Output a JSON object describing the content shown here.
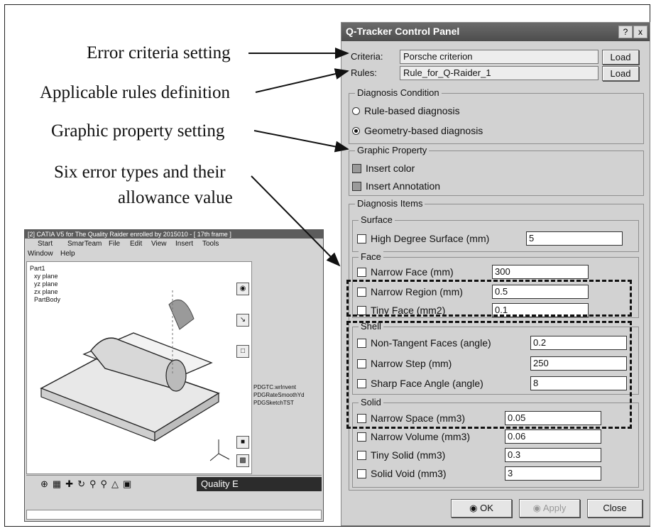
{
  "annotations": {
    "error_criteria": "Error criteria setting",
    "applicable_rules": "Applicable rules definition",
    "graphic_property": "Graphic property setting",
    "six_types_line1": "Six error types and their",
    "six_types_line2": "allowance value"
  },
  "panel": {
    "title": "Q-Tracker Control Panel",
    "help_btn": "?",
    "close_btn": "x",
    "criteria": {
      "label": "Criteria:",
      "value": "Porsche criterion",
      "button": "Load"
    },
    "rules": {
      "label": "Rules:",
      "value": "Rule_for_Q-Raider_1",
      "button": "Load"
    },
    "diagnosis_condition": {
      "title": "Diagnosis Condition",
      "options": [
        {
          "label": "Rule-based diagnosis",
          "selected": false
        },
        {
          "label": "Geometry-based diagnosis",
          "selected": true
        }
      ]
    },
    "graphic_property": {
      "title": "Graphic Property",
      "options": [
        {
          "label": "Insert color",
          "checked": true
        },
        {
          "label": "Insert Annotation",
          "checked": true
        }
      ]
    },
    "diagnosis_items": {
      "title": "Diagnosis Items",
      "surface": {
        "title": "Surface",
        "items": [
          {
            "label": "High Degree Surface (mm)",
            "value": "5"
          }
        ]
      },
      "face": {
        "title": "Face",
        "items": [
          {
            "label": "Narrow Face (mm)",
            "value": "300"
          },
          {
            "label": "Narrow Region (mm)",
            "value": "0.5"
          },
          {
            "label": "Tiny Face (mm2)",
            "value": "0.1"
          }
        ]
      },
      "shell": {
        "title": "Shell",
        "items": [
          {
            "label": "Non-Tangent Faces (angle)",
            "value": "0.2"
          },
          {
            "label": "Narrow Step (mm)",
            "value": "250"
          },
          {
            "label": "Sharp Face Angle (angle)",
            "value": "8"
          }
        ]
      },
      "solid": {
        "title": "Solid",
        "items": [
          {
            "label": "Narrow Space (mm3)",
            "value": "0.05"
          },
          {
            "label": "Narrow Volume (mm3)",
            "value": "0.06"
          },
          {
            "label": "Tiny Solid (mm3)",
            "value": "0.3"
          },
          {
            "label": "Solid Void (mm3)",
            "value": "3"
          }
        ]
      }
    },
    "footer": {
      "ok": "OK",
      "apply": "Apply",
      "close": "Close"
    }
  },
  "catia": {
    "title": "[2] CATIA V5 for The Quality Raider enrolled by 2015010 - [ 17th frame ]",
    "menu_row1": [
      "Start",
      "SmarTeam",
      "File",
      "Edit",
      "View",
      "Insert",
      "Tools"
    ],
    "menu_row2": [
      "Window",
      "Help"
    ],
    "tree": [
      "Part1",
      "xy plane",
      "yz plane",
      "zx plane",
      "PartBody"
    ],
    "side_list": [
      "PDGTC.wrlnvent",
      "PDGRateSmoothYd",
      "PDGSketchTST"
    ],
    "quality_label": "Quality E"
  }
}
